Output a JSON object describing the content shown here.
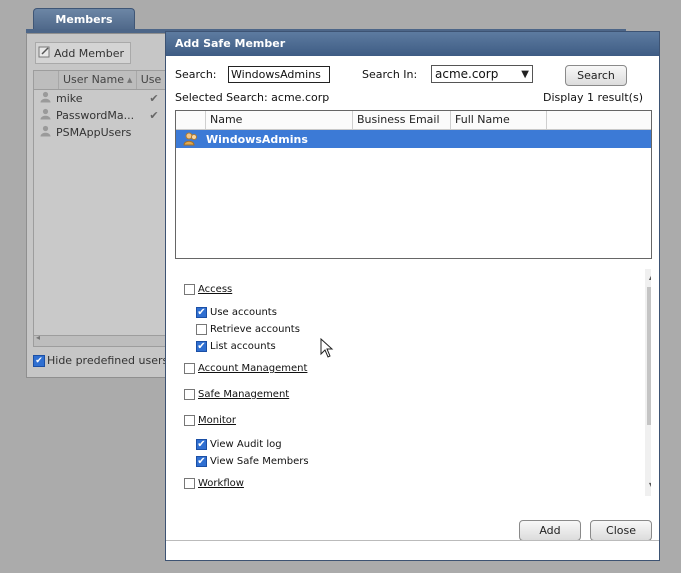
{
  "members_tab": {
    "label": "Members"
  },
  "members_panel": {
    "add_member_label": "Add Member",
    "columns": [
      "User Name",
      "Use"
    ],
    "sort_glyph": "▲",
    "rows": [
      {
        "name": "mike",
        "check": "✔"
      },
      {
        "name": "PasswordMa...",
        "check": "✔"
      },
      {
        "name": "PSMAppUsers",
        "check": ""
      }
    ],
    "hide_predefined_label": "Hide predefined users and"
  },
  "dialog": {
    "title": "Add Safe Member",
    "search_label": "Search:",
    "search_value": "WindowsAdmins",
    "search_in_label": "Search In:",
    "search_in_value": "acme.corp",
    "search_button": "Search",
    "selected_search": "Selected Search: acme.corp",
    "display_count": "Display 1 result(s)",
    "columns": [
      "Name",
      "Business Email",
      "Full Name"
    ],
    "result_rows": [
      {
        "name": "WindowsAdmins"
      }
    ],
    "permissions": [
      {
        "label": "Access",
        "checked": false,
        "group": true
      },
      {
        "label": "Use accounts",
        "checked": true,
        "group": false
      },
      {
        "label": "Retrieve accounts",
        "checked": false,
        "group": false
      },
      {
        "label": "List accounts",
        "checked": true,
        "group": false
      },
      {
        "label": "Account Management",
        "checked": false,
        "group": true
      },
      {
        "label": "Safe Management",
        "checked": false,
        "group": true
      },
      {
        "label": "Monitor",
        "checked": false,
        "group": true
      },
      {
        "label": "View Audit log",
        "checked": true,
        "group": false
      },
      {
        "label": "View Safe Members",
        "checked": true,
        "group": false
      },
      {
        "label": "Workflow",
        "checked": false,
        "group": true
      }
    ],
    "add_button": "Add",
    "close_button": "Close"
  },
  "colors": {
    "title_bar": "#3e5c84",
    "selection": "#3c7ad6",
    "checkbox_on": "#2f6fd1"
  }
}
